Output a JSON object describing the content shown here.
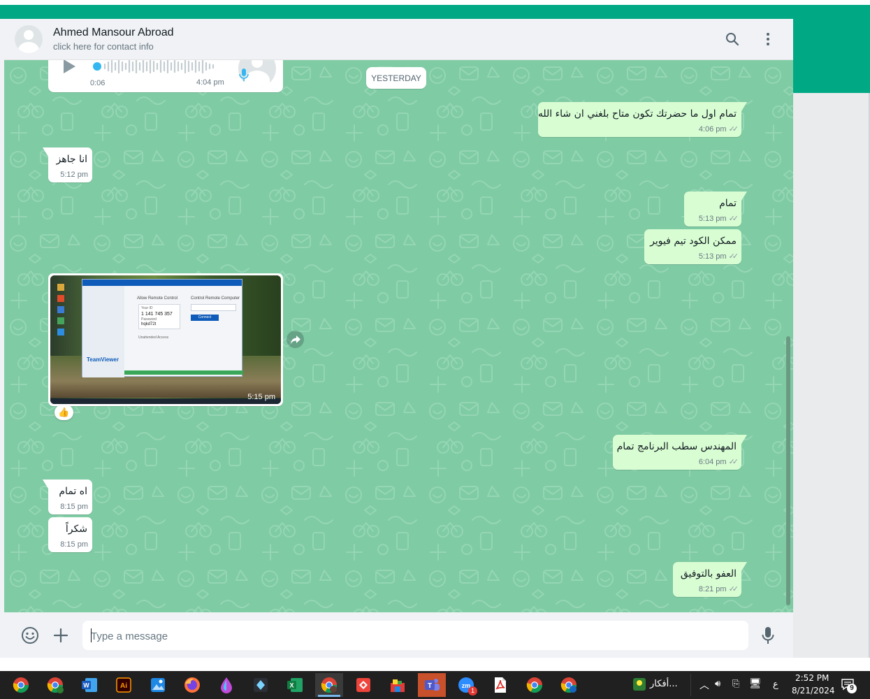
{
  "header": {
    "contact_name": "Ahmed Mansour Abroad",
    "contact_sub": "click here for contact info"
  },
  "chat": {
    "date_separator": "YESTERDAY",
    "voice_note": {
      "duration": "0:06",
      "time": "4:04 pm"
    },
    "messages": [
      {
        "dir": "out",
        "text": "تمام اول ما حضرتك تكون متاح بلغني ان شاء الله",
        "time": "4:06 pm"
      },
      {
        "dir": "in",
        "text": "انا جاهز",
        "time": "5:12 pm"
      },
      {
        "dir": "out",
        "text": "تمام",
        "time": "5:13 pm"
      },
      {
        "dir": "out",
        "text": "ممكن الكود تيم فيوير",
        "time": "5:13 pm"
      },
      {
        "dir": "out",
        "text": "المهندس سطب البرنامج تمام",
        "time": "6:04 pm"
      },
      {
        "dir": "in",
        "text": "اه تمام",
        "time": "8:15 pm"
      },
      {
        "dir": "in",
        "text": "شكراً",
        "time": "8:15 pm"
      },
      {
        "dir": "out",
        "text": "العفو بالتوفيق",
        "time": "8:21 pm"
      }
    ],
    "image_message": {
      "time": "5:15 pm",
      "reaction": "👍",
      "screenshot": {
        "panel_left_title": "Allow Remote Control",
        "panel_right_title": "Control Remote Computer",
        "your_id_label": "Your ID",
        "your_id": "1 141 745 357",
        "password_label": "Password",
        "password": "hqkd72t",
        "connect_label": "Connect",
        "unattended_label": "Unattended Access",
        "brand": "TeamViewer"
      }
    }
  },
  "composer": {
    "placeholder": "Type a message"
  },
  "taskbar": {
    "app_label": "أفكار...",
    "lang": "ع",
    "time": "2:52 PM",
    "date": "8/21/2024",
    "notification_count": "9",
    "zoom_badge": "1"
  }
}
